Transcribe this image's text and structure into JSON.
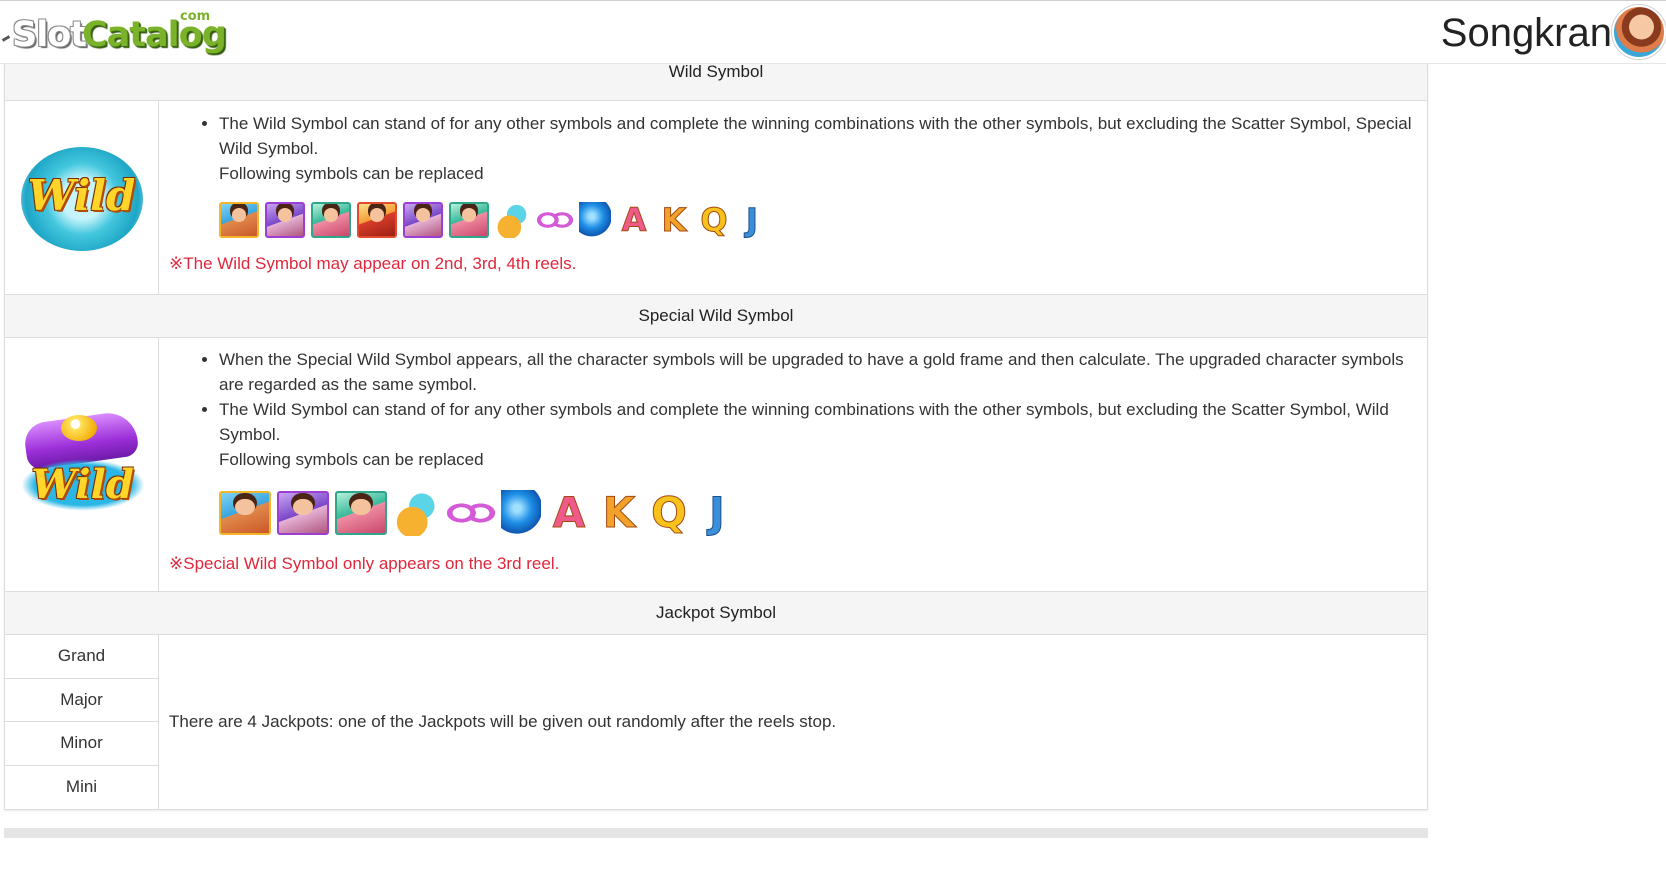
{
  "header": {
    "logo": {
      "part1": "Slot",
      "part2": "Catalog",
      "suffix": "com"
    },
    "game_title": "Songkran"
  },
  "wild_section": {
    "heading": "Wild Symbol",
    "badge_text": "Wild",
    "bullet": "The Wild Symbol can stand of for any other symbols and complete the winning combinations with the other symbols, but excluding the Scatter Symbol, Special Wild Symbol.",
    "replace_label": "Following symbols can be replaced",
    "icons": [
      "character-1-icon",
      "character-2-icon",
      "character-3-icon",
      "character-4-icon",
      "character-5-icon",
      "character-6-icon",
      "water-bucket-icon",
      "goggles-icon",
      "water-balloon-icon",
      "letter-a-icon",
      "letter-k-icon",
      "letter-q-icon",
      "letter-j-icon"
    ],
    "letters": {
      "a": "A",
      "k": "K",
      "q": "Q",
      "j": "J"
    },
    "note": "※The Wild Symbol may appear on 2nd, 3rd, 4th reels."
  },
  "special_wild_section": {
    "heading": "Special Wild Symbol",
    "badge_text": "Wild",
    "bullets": [
      "When the Special Wild Symbol appears, all the character symbols will be upgraded to have a gold frame and then calculate. The upgraded character symbols are regarded as the same symbol.",
      "The Wild Symbol can stand of for any other symbols and complete the winning combinations with the other symbols, but excluding the Scatter Symbol, Wild Symbol."
    ],
    "replace_label": "Following symbols can be replaced",
    "note": "※Special Wild Symbol only appears on the 3rd reel."
  },
  "jackpot_section": {
    "heading": "Jackpot Symbol",
    "levels": [
      "Grand",
      "Major",
      "Minor",
      "Mini"
    ],
    "description": "There are 4 Jackpots: one of the Jackpots will be given out randomly after the reels stop."
  },
  "colors": {
    "note_red": "#e0283c",
    "header_bg": "#f5f5f5",
    "border": "#dcdcdc"
  }
}
